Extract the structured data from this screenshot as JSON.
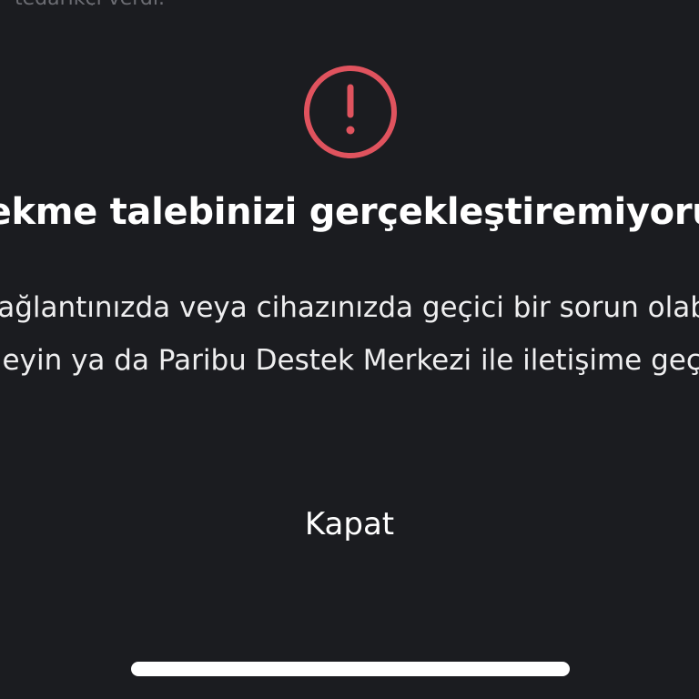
{
  "background_text": "tedarikçi verdi.",
  "dialog": {
    "icon": "exclamation-circle-icon",
    "title": "Çekme talebinizi gerçekleştiremiyoruz",
    "message_line1": "İnternet bağlantınızda veya cihazınızda geçici bir sorun olabilir. Sonra",
    "message_line2": "tekrar deneyin ya da Paribu Destek Merkezi ile iletişime geçebilirsiniz.",
    "close_label": "Kapat"
  },
  "colors": {
    "background": "#1b1c20",
    "alert_red": "#e0535e",
    "text": "#ffffff"
  }
}
